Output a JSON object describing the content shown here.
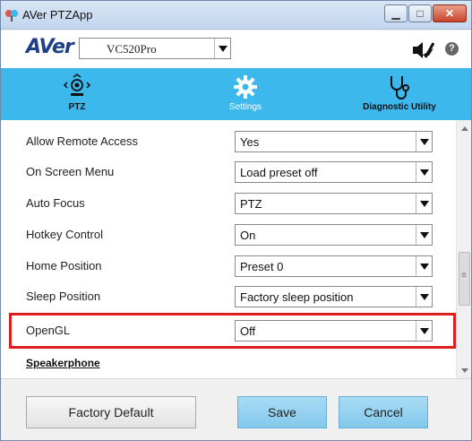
{
  "window": {
    "title": "AVer PTZApp",
    "icon": "aver-app-icon"
  },
  "header": {
    "logo_text": "AVer",
    "device_select": {
      "value": "VC520Pro"
    },
    "mute_icon": "microphone-muted-icon",
    "help_icon": "?"
  },
  "tabs": [
    {
      "label": "PTZ",
      "icon": "ptz-camera-icon",
      "active": false
    },
    {
      "label": "Settings",
      "icon": "gear-icon",
      "active": true
    },
    {
      "label": "Diagnostic Utility",
      "icon": "stethoscope-icon",
      "active": false
    }
  ],
  "settings": [
    {
      "label": "Allow Remote Access",
      "value": "Yes"
    },
    {
      "label": "On Screen Menu",
      "value": "Load preset off"
    },
    {
      "label": "Auto Focus",
      "value": "PTZ"
    },
    {
      "label": "Hotkey Control",
      "value": "On"
    },
    {
      "label": "Home Position",
      "value": "Preset 0"
    },
    {
      "label": "Sleep Position",
      "value": "Factory sleep position"
    },
    {
      "label": "OpenGL",
      "value": "Off"
    }
  ],
  "section": {
    "title": "Speakerphone"
  },
  "footer": {
    "factory_default": "Factory Default",
    "save": "Save",
    "cancel": "Cancel"
  },
  "colors": {
    "tab_bar": "#3cb8ec",
    "highlight": "#e01d1d",
    "button": "#82c8ec"
  }
}
